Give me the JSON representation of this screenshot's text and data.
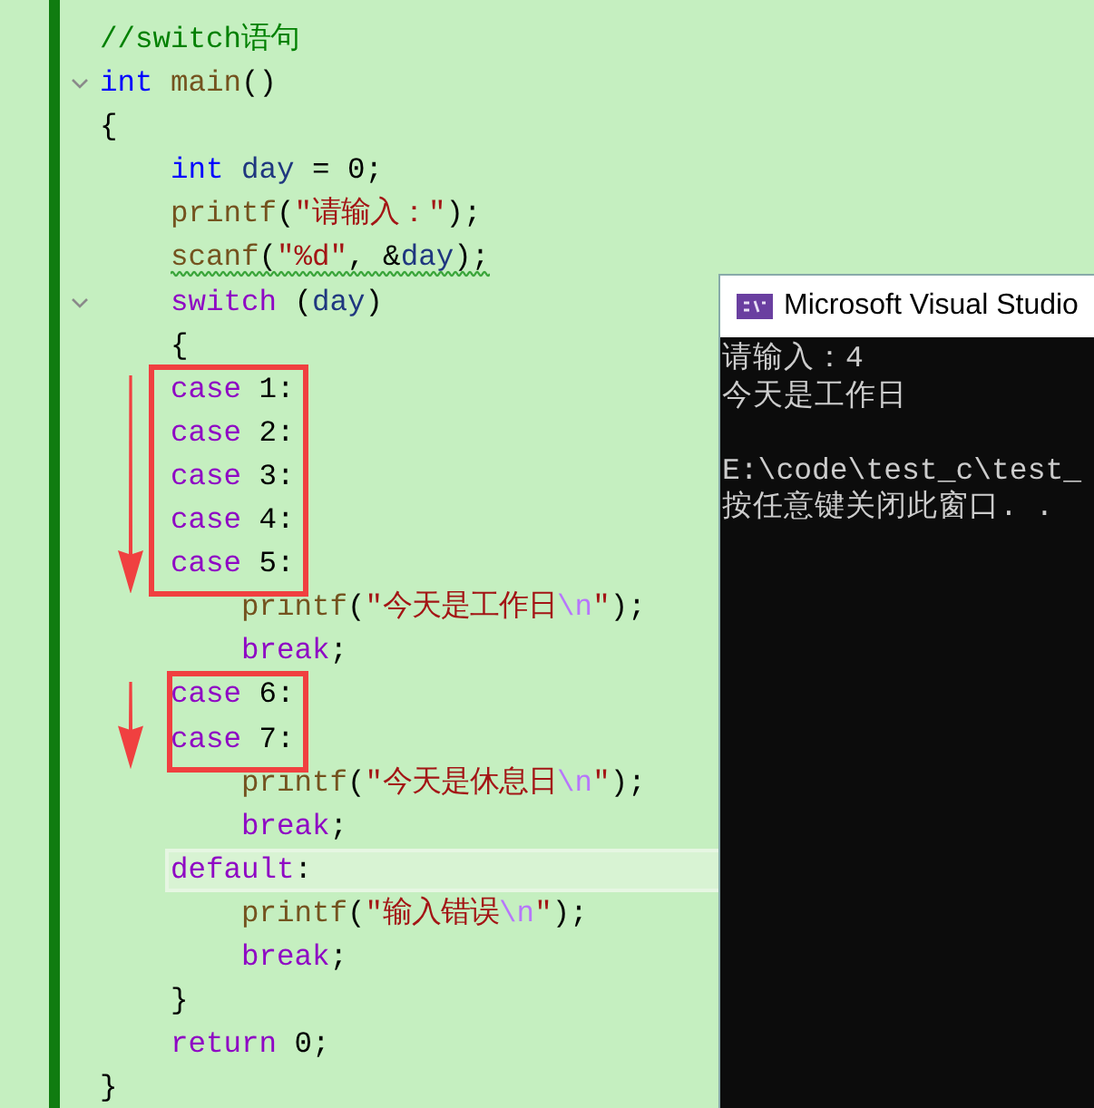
{
  "editor": {
    "lines": [
      {
        "fold": false,
        "tokens": [
          {
            "kind": "comment",
            "text": "//switch语句"
          }
        ]
      },
      {
        "fold": true,
        "tokens": [
          {
            "kind": "type",
            "text": "int "
          },
          {
            "kind": "function",
            "text": "main"
          },
          {
            "kind": "plain",
            "text": "()"
          }
        ]
      },
      {
        "fold": false,
        "tokens": [
          {
            "kind": "plain",
            "text": "{"
          }
        ]
      },
      {
        "kind": "block",
        "lines": [
          {
            "fold": false,
            "tokens": [
              {
                "kind": "type",
                "text": "int "
              },
              {
                "kind": "variable",
                "text": "day"
              },
              {
                "kind": "plain",
                "text": " = 0;"
              }
            ]
          },
          {
            "fold": false,
            "tokens": [
              {
                "kind": "function",
                "text": "printf"
              },
              {
                "kind": "plain",
                "text": "("
              },
              {
                "kind": "string",
                "text": "\"请输入：\""
              },
              {
                "kind": "plain",
                "text": ");"
              }
            ]
          },
          {
            "fold": false,
            "warning": true,
            "tokens": [
              {
                "kind": "function",
                "text": "scanf"
              },
              {
                "kind": "plain",
                "text": "("
              },
              {
                "kind": "string",
                "text": "\"%d\""
              },
              {
                "kind": "plain",
                "text": ", &"
              },
              {
                "kind": "variable",
                "text": "day"
              },
              {
                "kind": "plain",
                "text": ");"
              }
            ]
          },
          {
            "fold": true,
            "tokens": [
              {
                "kind": "control",
                "text": "switch"
              },
              {
                "kind": "plain",
                "text": " ("
              },
              {
                "kind": "variable",
                "text": "day"
              },
              {
                "kind": "plain",
                "text": ")"
              }
            ]
          },
          {
            "fold": false,
            "tokens": [
              {
                "kind": "plain",
                "text": "{"
              }
            ]
          },
          {
            "kind": "frame",
            "lines": [
              {
                "fold": false,
                "tokens": [
                  {
                    "kind": "control",
                    "text": "case"
                  },
                  {
                    "kind": "plain",
                    "text": " 1:"
                  }
                ]
              },
              {
                "fold": false,
                "tokens": [
                  {
                    "kind": "control",
                    "text": "case"
                  },
                  {
                    "kind": "plain",
                    "text": " 2:"
                  }
                ]
              },
              {
                "fold": false,
                "tokens": [
                  {
                    "kind": "control",
                    "text": "case"
                  },
                  {
                    "kind": "plain",
                    "text": " 3:"
                  }
                ]
              },
              {
                "fold": false,
                "tokens": [
                  {
                    "kind": "control",
                    "text": "case"
                  },
                  {
                    "kind": "plain",
                    "text": " 4:"
                  }
                ]
              },
              {
                "fold": false,
                "tokens": [
                  {
                    "kind": "control",
                    "text": "case"
                  },
                  {
                    "kind": "plain",
                    "text": " 5:"
                  }
                ]
              }
            ]
          },
          {
            "kind": "block",
            "lines": [
              {
                "fold": false,
                "tokens": [
                  {
                    "kind": "function",
                    "text": "printf"
                  },
                  {
                    "kind": "plain",
                    "text": "("
                  },
                  {
                    "kind": "string",
                    "text": "\"今天是工作日"
                  },
                  {
                    "kind": "escape",
                    "text": "\\n"
                  },
                  {
                    "kind": "string",
                    "text": "\""
                  },
                  {
                    "kind": "plain",
                    "text": ");"
                  }
                ]
              },
              {
                "fold": false,
                "tokens": [
                  {
                    "kind": "control",
                    "text": "break"
                  },
                  {
                    "kind": "plain",
                    "text": ";"
                  }
                ]
              }
            ]
          },
          {
            "kind": "frame",
            "lines": [
              {
                "fold": false,
                "tokens": [
                  {
                    "kind": "control",
                    "text": "case"
                  },
                  {
                    "kind": "plain",
                    "text": " 6:"
                  }
                ]
              },
              {
                "fold": false,
                "tokens": [
                  {
                    "kind": "control",
                    "text": "case"
                  },
                  {
                    "kind": "plain",
                    "text": " 7:"
                  }
                ]
              }
            ]
          },
          {
            "kind": "block",
            "lines": [
              {
                "fold": false,
                "tokens": [
                  {
                    "kind": "function",
                    "text": "printf"
                  },
                  {
                    "kind": "plain",
                    "text": "("
                  },
                  {
                    "kind": "string",
                    "text": "\"今天是休息日"
                  },
                  {
                    "kind": "escape",
                    "text": "\\n"
                  },
                  {
                    "kind": "string",
                    "text": "\""
                  },
                  {
                    "kind": "plain",
                    "text": ");"
                  }
                ]
              },
              {
                "fold": false,
                "tokens": [
                  {
                    "kind": "control",
                    "text": "break"
                  },
                  {
                    "kind": "plain",
                    "text": ";"
                  }
                ]
              }
            ]
          },
          {
            "fold": false,
            "current": true,
            "tokens": [
              {
                "kind": "control",
                "text": "default"
              },
              {
                "kind": "plain",
                "text": ":"
              }
            ]
          },
          {
            "kind": "block",
            "lines": [
              {
                "fold": false,
                "tokens": [
                  {
                    "kind": "function",
                    "text": "printf"
                  },
                  {
                    "kind": "plain",
                    "text": "("
                  },
                  {
                    "kind": "string",
                    "text": "\"输入错误"
                  },
                  {
                    "kind": "escape",
                    "text": "\\n"
                  },
                  {
                    "kind": "string",
                    "text": "\""
                  },
                  {
                    "kind": "plain",
                    "text": ");"
                  }
                ]
              },
              {
                "fold": false,
                "tokens": [
                  {
                    "kind": "control",
                    "text": "break"
                  },
                  {
                    "kind": "plain",
                    "text": ";"
                  }
                ]
              }
            ]
          },
          {
            "fold": false,
            "tokens": [
              {
                "kind": "plain",
                "text": "}"
              }
            ]
          },
          {
            "fold": false,
            "tokens": [
              {
                "kind": "control",
                "text": "return"
              },
              {
                "kind": "plain",
                "text": " 0;"
              }
            ]
          }
        ]
      },
      {
        "fold": false,
        "tokens": [
          {
            "kind": "plain",
            "text": "}"
          }
        ]
      }
    ]
  },
  "console": {
    "title": "Microsoft Visual Studio",
    "output_lines": [
      "请输入：4",
      "今天是工作日"
    ],
    "exit_lines": [
      "E:\\code\\test_c\\test_",
      "按任意键关闭此窗口. ."
    ]
  }
}
